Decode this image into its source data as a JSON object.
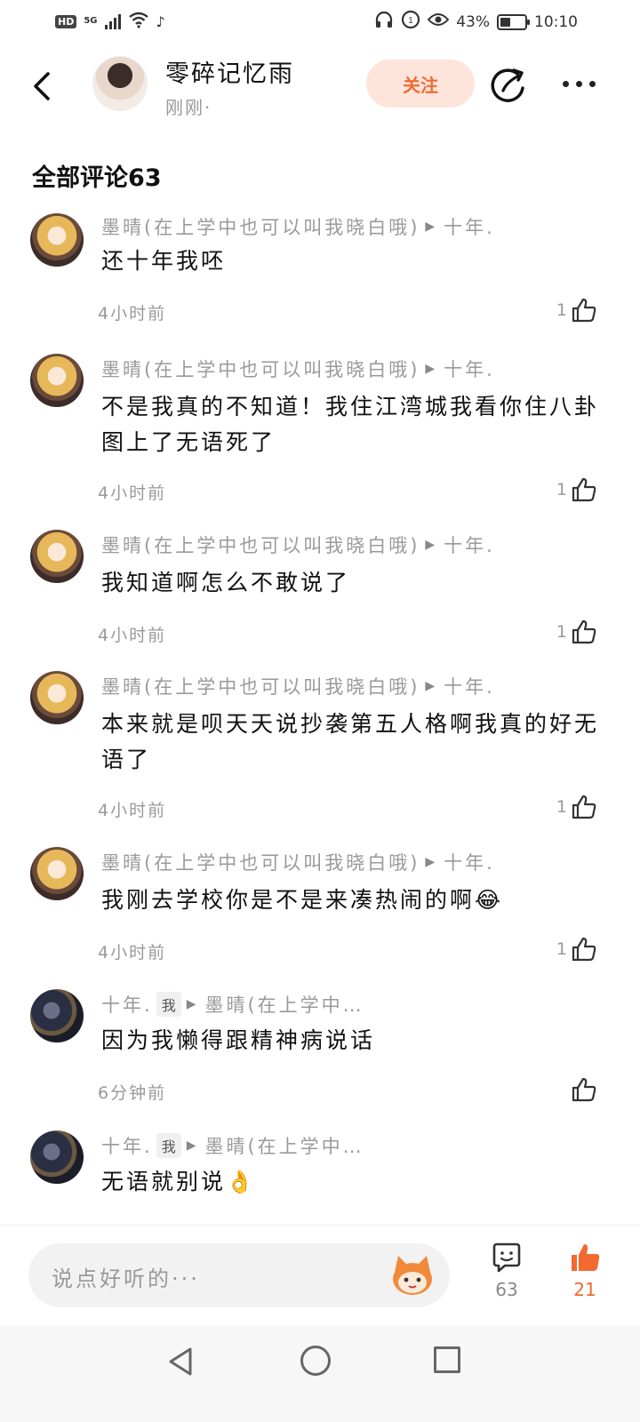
{
  "status_bar": {
    "hd": "HD",
    "network": "5G",
    "battery_text": "43%",
    "battery_level": 0.43,
    "time": "10:10"
  },
  "header": {
    "author_name": "零碎记忆雨",
    "post_time": "刚刚·",
    "follow_label": "关注"
  },
  "section_title": "全部评论63",
  "comments": [
    {
      "user": "墨晴(在上学中也可以叫我晓白哦)",
      "reply_to": "十年.",
      "text": "还十年我呸",
      "time": "4小时前",
      "likes": "1",
      "avatar": "girl-avatar"
    },
    {
      "user": "墨晴(在上学中也可以叫我晓白哦)",
      "reply_to": "十年.",
      "text": "不是我真的不知道！我住江湾城我看你住八卦图上了无语死了",
      "time": "4小时前",
      "likes": "1",
      "avatar": "girl-avatar"
    },
    {
      "user": "墨晴(在上学中也可以叫我晓白哦)",
      "reply_to": "十年.",
      "text": "我知道啊怎么不敢说了",
      "time": "4小时前",
      "likes": "1",
      "avatar": "girl-avatar"
    },
    {
      "user": "墨晴(在上学中也可以叫我晓白哦)",
      "reply_to": "十年.",
      "text": "本来就是呗天天说抄袭第五人格啊我真的好无语了",
      "time": "4小时前",
      "likes": "1",
      "avatar": "girl-avatar"
    },
    {
      "user": "墨晴(在上学中也可以叫我晓白哦)",
      "reply_to": "十年.",
      "text": "我刚去学校你是不是来凑热闹的啊😂",
      "time": "4小时前",
      "likes": "1",
      "avatar": "girl-avatar"
    },
    {
      "user": "十年.",
      "me_badge": "我",
      "reply_to": "墨晴(在上学中…",
      "text": "因为我懒得跟精神病说话",
      "time": "6分钟前",
      "likes": "",
      "avatar": "dark-avatar"
    },
    {
      "user": "十年.",
      "me_badge": "我",
      "reply_to": "墨晴(在上学中…",
      "text": "无语就别说👌",
      "time": "",
      "likes": "",
      "avatar": "dark-avatar"
    }
  ],
  "bottom_bar": {
    "input_placeholder": "说点好听的···",
    "comment_count": "63",
    "like_count": "21"
  },
  "colors": {
    "accent": "#f26a30",
    "follow_bg": "#fde5dc",
    "muted_text": "#999999"
  }
}
